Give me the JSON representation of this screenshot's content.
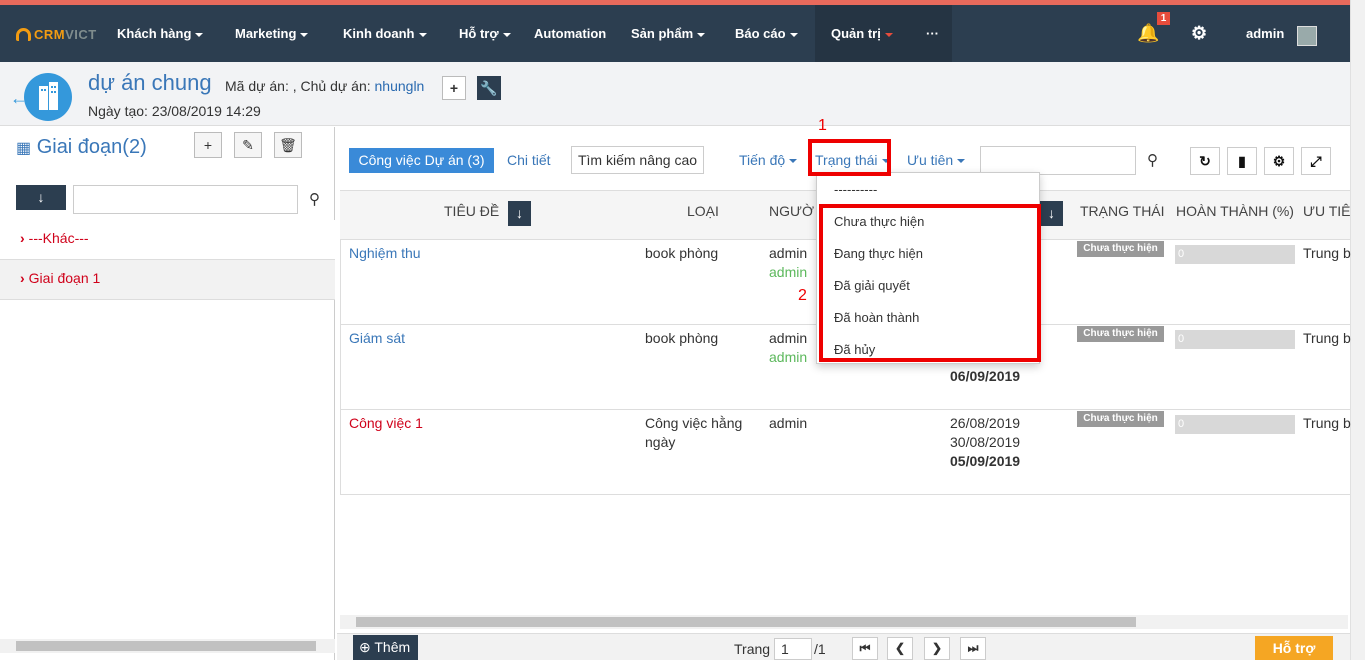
{
  "brand": {
    "a": "CRM",
    "b": "VICT"
  },
  "nav": {
    "items": [
      "Khách hàng",
      "Marketing",
      "Kinh doanh",
      "Hỗ trợ",
      "Automation",
      "Sản phẩm",
      "Báo cáo",
      "Quản trị",
      "···"
    ],
    "notif_count": "1",
    "user": "admin"
  },
  "project": {
    "title": "dự án chung",
    "code_label": "Mã dự án: ,",
    "owner_label": "Chủ dự án:",
    "owner": "nhungln",
    "created": "Ngày tạo: 23/08/2019 14:29"
  },
  "left": {
    "title": "Giai đoạn(2)",
    "items": [
      "---Khác---",
      "Giai đoạn 1"
    ]
  },
  "toolbar": {
    "tab_active": "Công việc Dự án (3)",
    "detail": "Chi tiết",
    "advanced": "Tìm kiếm nâng cao",
    "progress": "Tiến độ",
    "status": "Trạng thái",
    "priority": "Ưu tiên"
  },
  "table": {
    "headers": [
      "TIÊU ĐỀ",
      "LOẠI",
      "NGƯỜ",
      "TRẠNG THÁI",
      "HOÀN THÀNH (%)",
      "ƯU TIÊ"
    ],
    "rows": [
      {
        "title": "Nghiệm thu",
        "type": "book phòng",
        "person": "admin",
        "person2": "admin",
        "dates": [
          "",
          "",
          ""
        ],
        "status": "Chưa thực hiện",
        "progress": "0",
        "priority": "Trung b"
      },
      {
        "title": "Giám sát",
        "type": "book phòng",
        "person": "admin",
        "person2": "admin",
        "dates": [
          "",
          "",
          "06/09/2019"
        ],
        "status": "Chưa thực hiện",
        "progress": "0",
        "priority": "Trung b"
      },
      {
        "title": "Công việc 1",
        "type": "Công việc hằng ngày",
        "person": "admin",
        "person2": "",
        "dates": [
          "26/08/2019",
          "30/08/2019",
          "05/09/2019"
        ],
        "status": "Chưa thực hiện",
        "progress": "0",
        "priority": "Trung b"
      }
    ]
  },
  "dropdown": {
    "items": [
      "----------",
      "Chưa thực hiện",
      "Đang thực hiện",
      "Đã giải quyết",
      "Đã hoàn thành",
      "Đã hủy"
    ]
  },
  "markers": {
    "one": "1",
    "two": "2"
  },
  "footer": {
    "add": "Thêm",
    "page_label": "Trang",
    "page": "1",
    "total": "/1",
    "help": "Hỗ trợ"
  },
  "colors": {
    "navbar": "#2c3e50",
    "accent": "#3a8ad8",
    "highlight": "#e00000",
    "help": "#f5a623"
  }
}
